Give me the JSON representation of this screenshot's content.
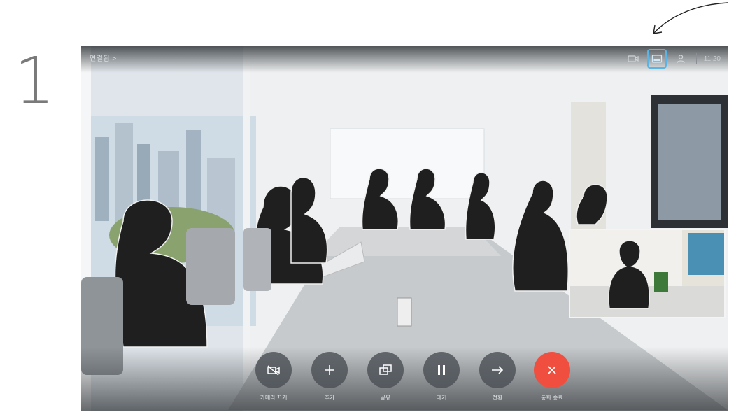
{
  "step": {
    "number": "1"
  },
  "screen": {
    "call_label": "연결됨 >",
    "clock": "11:20",
    "top_icons": [
      "camera-icon",
      "layout-icon",
      "participants-icon"
    ],
    "active_top_icon": "layout-icon"
  },
  "controls": [
    {
      "id": "camera",
      "label": "카메라 끄기",
      "icon": "camera-icon",
      "color": "#4a4f55"
    },
    {
      "id": "add",
      "label": "추가",
      "icon": "plus-icon",
      "color": "#4a4f55"
    },
    {
      "id": "share",
      "label": "공유",
      "icon": "share-icon",
      "color": "#4a4f55"
    },
    {
      "id": "hold",
      "label": "대기",
      "icon": "pause-icon",
      "color": "#4a4f55"
    },
    {
      "id": "transfer",
      "label": "전환",
      "icon": "arrow-right-icon",
      "color": "#4a4f55"
    },
    {
      "id": "end",
      "label": "통화 종료",
      "icon": "close-icon",
      "color": "#f04e3e"
    }
  ],
  "colors": {
    "accent": "#5ab4e6",
    "end_call": "#f04e3e"
  }
}
